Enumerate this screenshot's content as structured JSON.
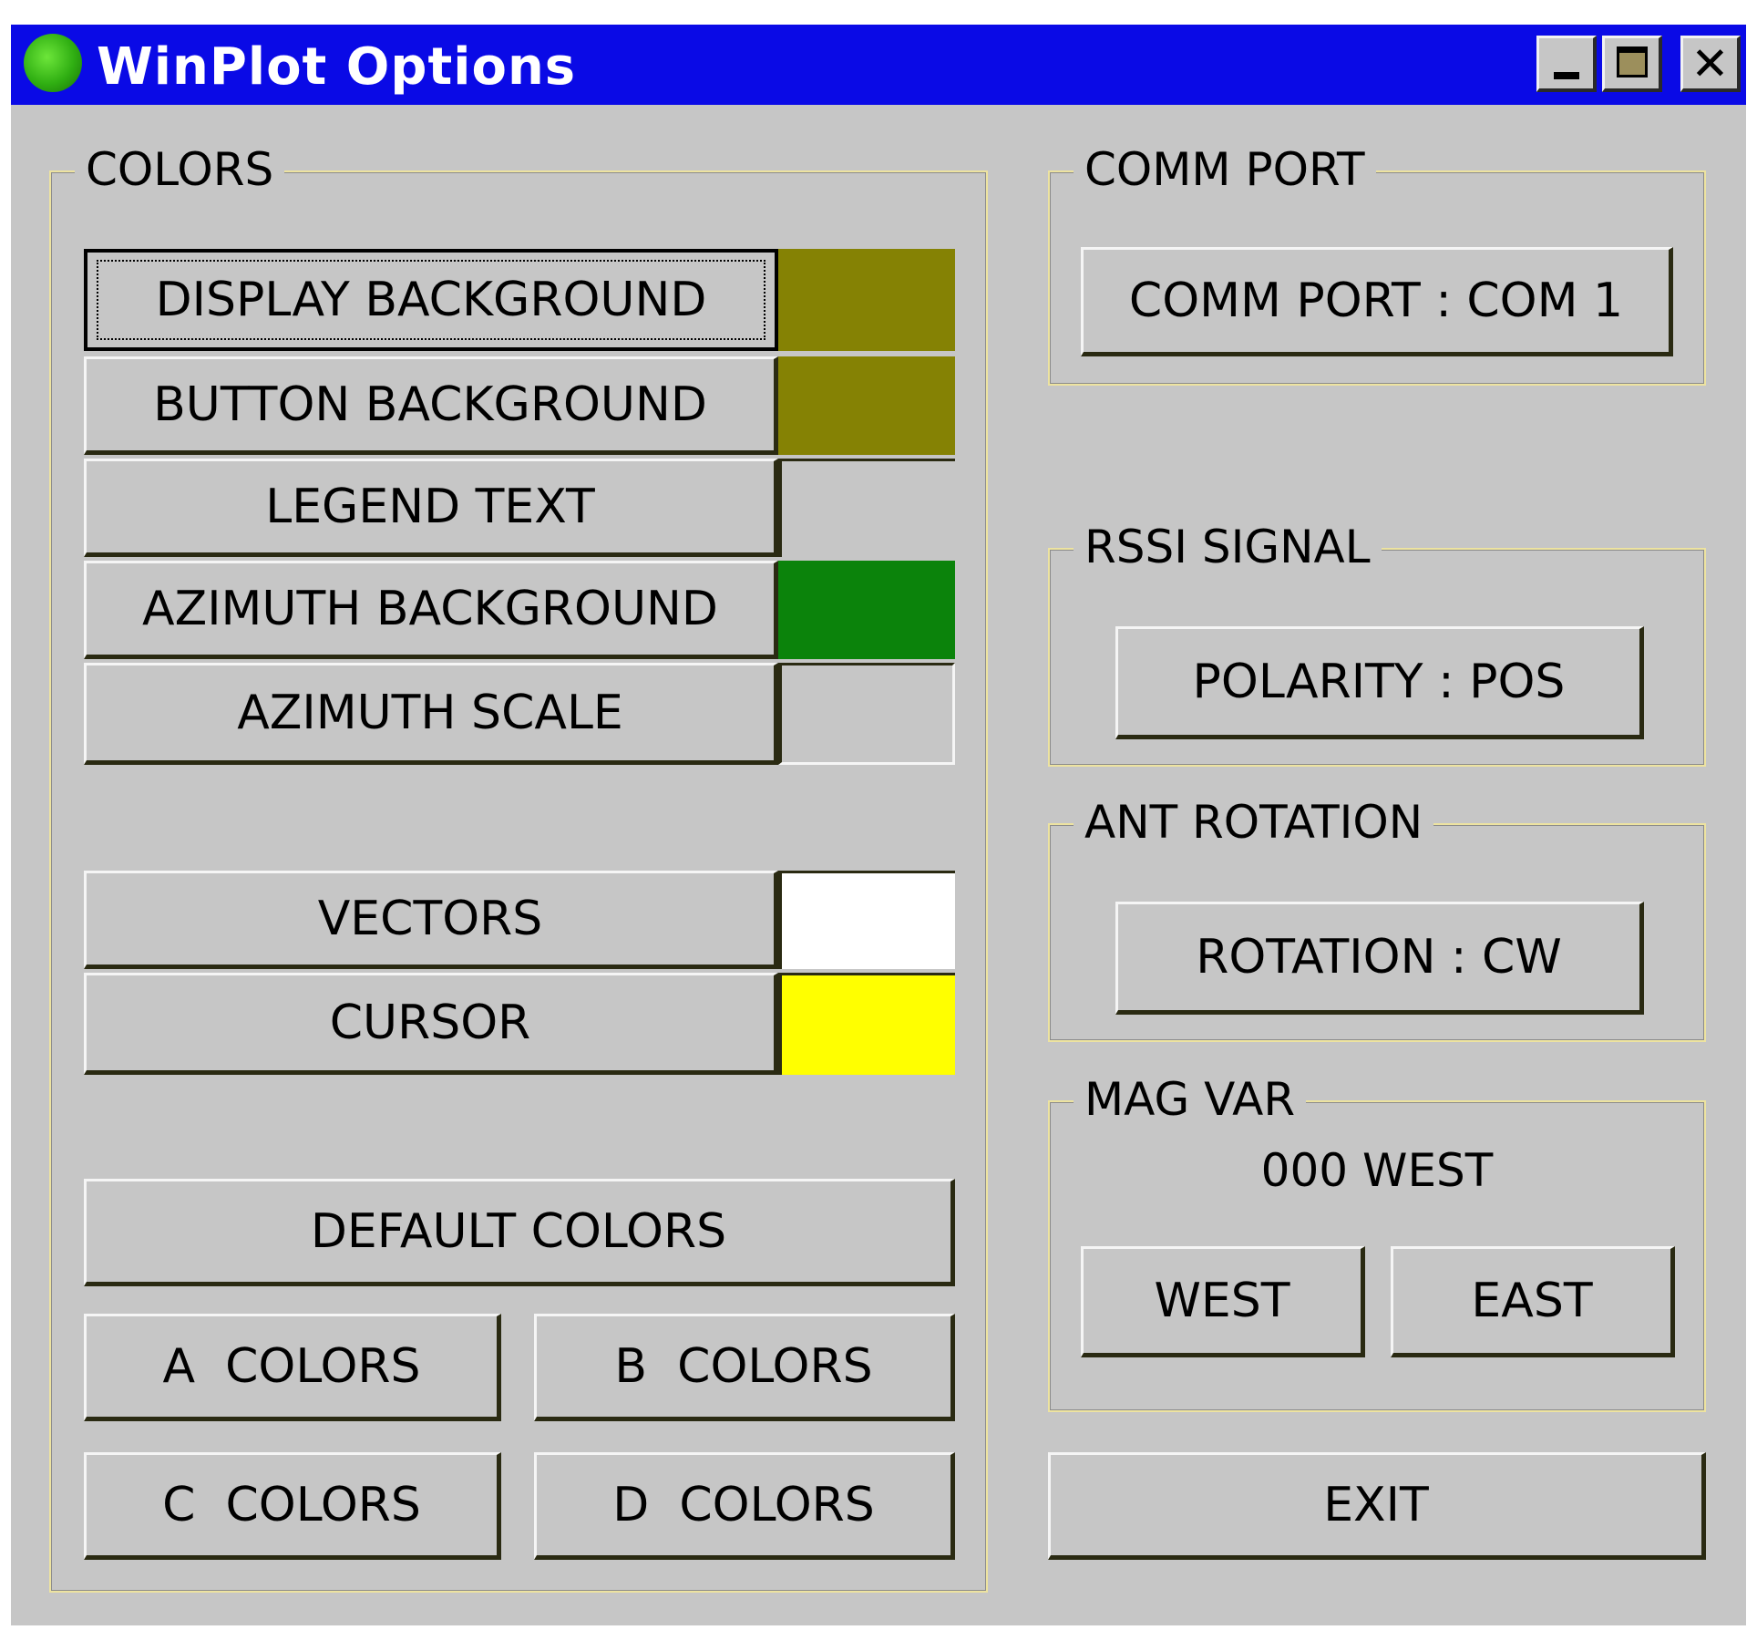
{
  "window": {
    "title": "WinPlot Options"
  },
  "colors": {
    "group_label": "COLORS",
    "items": [
      {
        "label": "DISPLAY BACKGROUND",
        "swatch": "#858204"
      },
      {
        "label": "BUTTON BACKGROUND",
        "swatch": "#858204"
      },
      {
        "label": "LEGEND TEXT",
        "swatch": "#c6c6c6"
      },
      {
        "label": "AZIMUTH BACKGROUND",
        "swatch": "#0b830b"
      },
      {
        "label": "AZIMUTH SCALE",
        "swatch": "#c6c6c6"
      },
      {
        "label": "VECTORS",
        "swatch": "#ffffff"
      },
      {
        "label": "CURSOR",
        "swatch": "#ffff00"
      }
    ],
    "default_button": "DEFAULT COLORS",
    "preset_buttons": [
      "A  COLORS",
      "B  COLORS",
      "C  COLORS",
      "D  COLORS"
    ]
  },
  "comm_port": {
    "group_label": "COMM PORT",
    "button": "COMM PORT : COM 1"
  },
  "rssi": {
    "group_label": "RSSI SIGNAL",
    "button": "POLARITY : POS"
  },
  "ant_rotation": {
    "group_label": "ANT ROTATION",
    "button": "ROTATION : CW"
  },
  "mag_var": {
    "group_label": "MAG VAR",
    "value": "000 WEST",
    "west_button": "WEST",
    "east_button": "EAST"
  },
  "exit_button": "EXIT"
}
